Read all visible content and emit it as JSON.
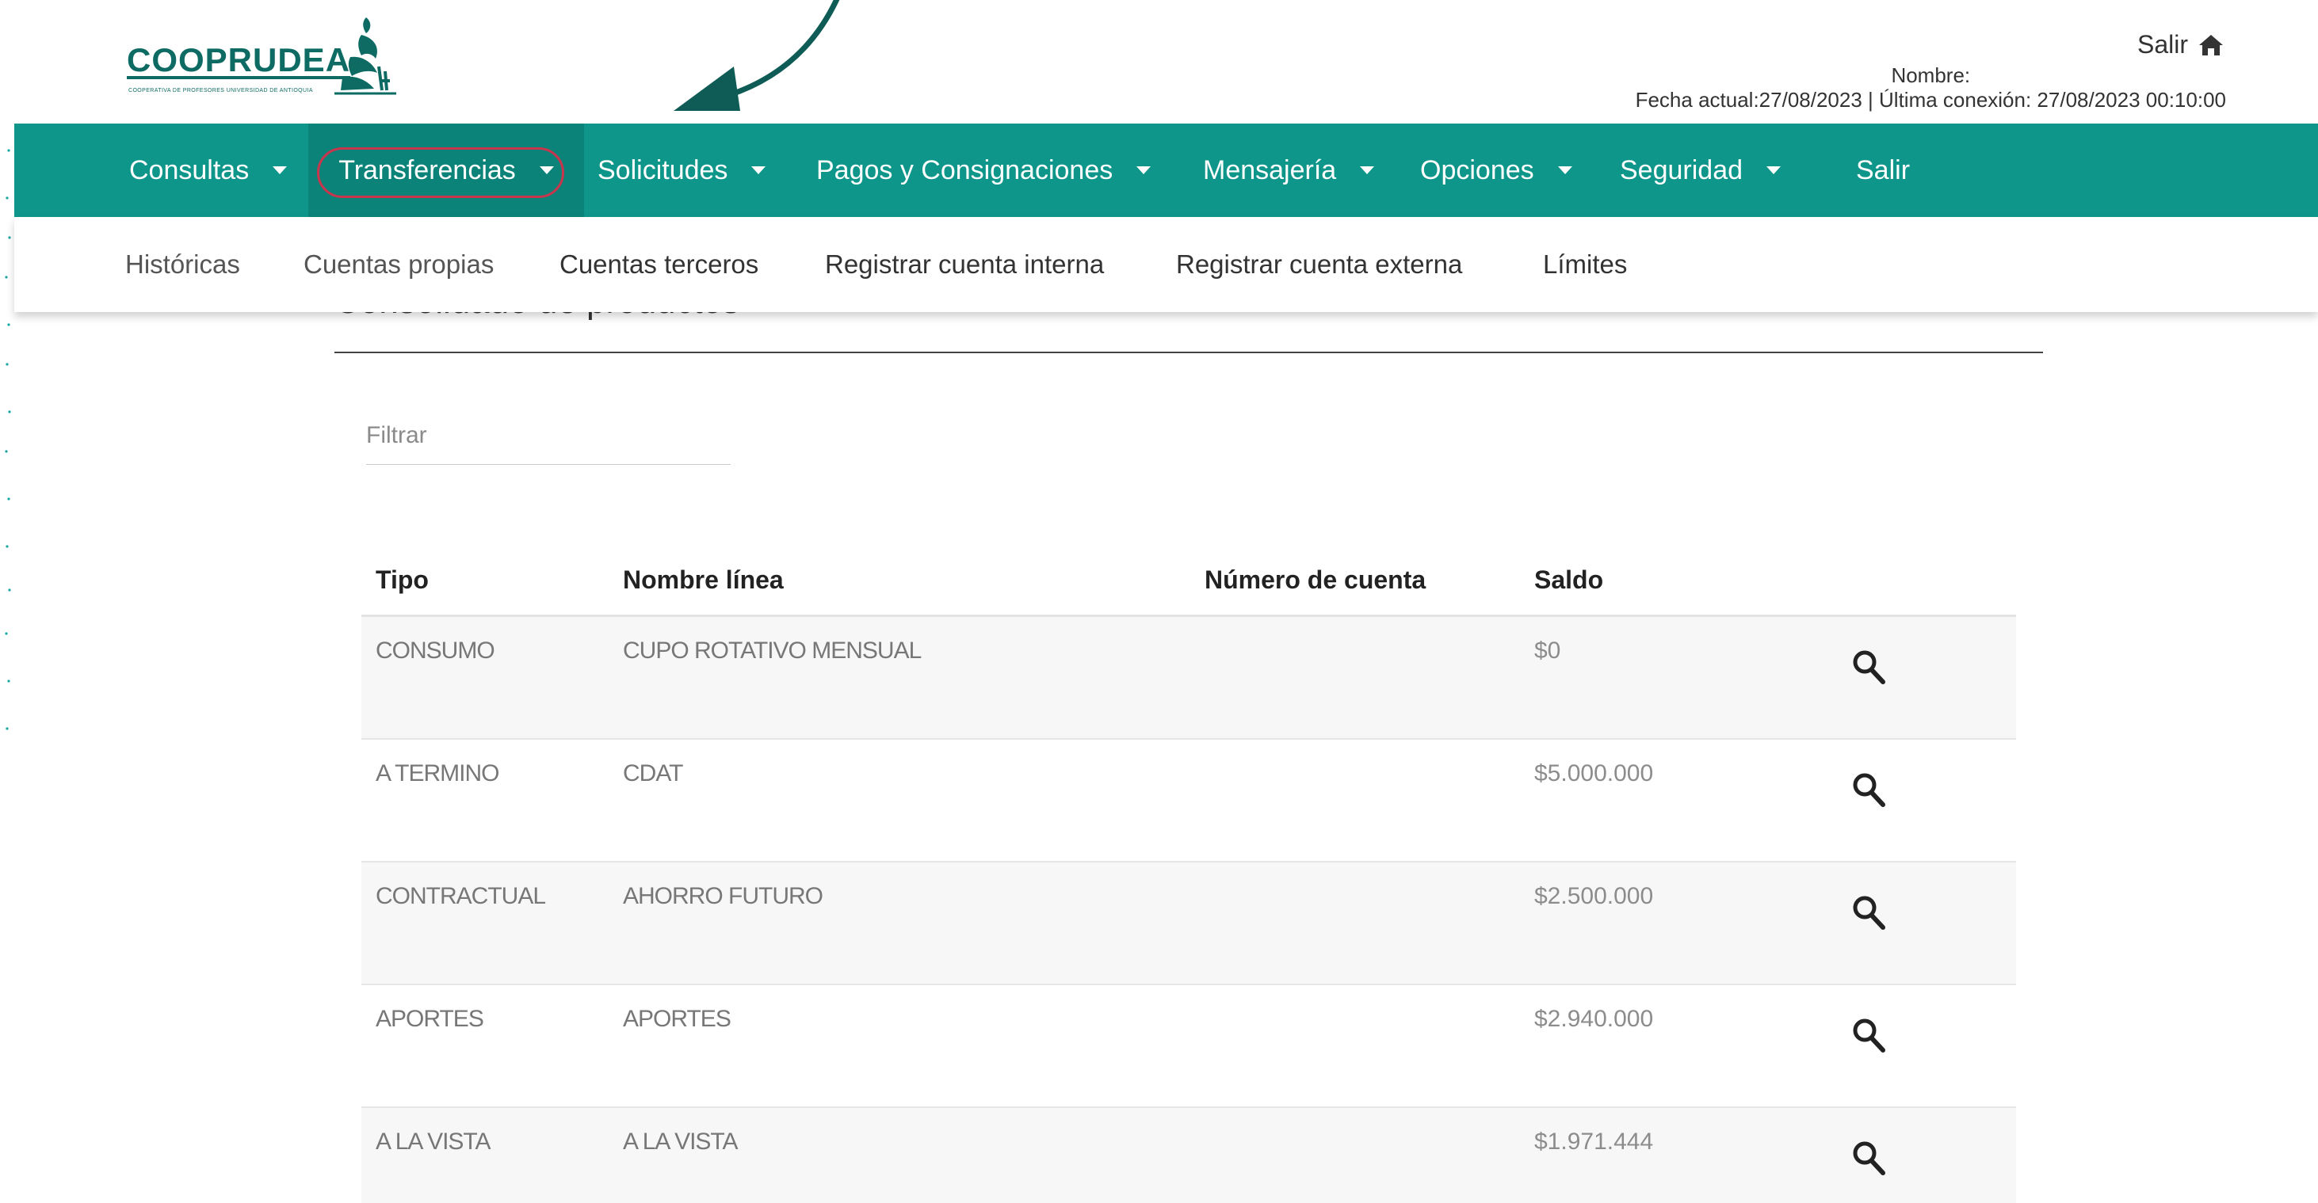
{
  "header": {
    "logo_text": "COOPRUDEA",
    "logo_subtitle": "COOPERATIVA DE PROFESORES UNIVERSIDAD DE ANTIOQUIA",
    "salir_label": "Salir",
    "nombre_label": "Nombre:",
    "fecha_line": "Fecha actual:27/08/2023 | Última conexión: 27/08/2023 00:10:00"
  },
  "nav": {
    "items": [
      {
        "label": "Consultas"
      },
      {
        "label": "Transferencias"
      },
      {
        "label": "Solicitudes"
      },
      {
        "label": "Pagos y Consignaciones"
      },
      {
        "label": "Mensajería"
      },
      {
        "label": "Opciones"
      },
      {
        "label": "Seguridad"
      },
      {
        "label": "Salir"
      }
    ],
    "active": "Transferencias"
  },
  "subnav": {
    "items": [
      {
        "label": "Históricas"
      },
      {
        "label": "Cuentas propias"
      },
      {
        "label": "Cuentas terceros"
      },
      {
        "label": "Registrar cuenta interna"
      },
      {
        "label": "Registrar cuenta externa"
      },
      {
        "label": "Límites"
      }
    ]
  },
  "main": {
    "section_title": "Consolidado de productos",
    "filter_placeholder": "Filtrar",
    "table": {
      "headers": {
        "tipo": "Tipo",
        "nombre": "Nombre línea",
        "numero": "Número de cuenta",
        "saldo": "Saldo"
      },
      "rows": [
        {
          "tipo": "CONSUMO",
          "nombre": "CUPO ROTATIVO MENSUAL",
          "numero": "",
          "saldo": "$0"
        },
        {
          "tipo": "A TERMINO",
          "nombre": "CDAT",
          "numero": "",
          "saldo": "$5.000.000"
        },
        {
          "tipo": "CONTRACTUAL",
          "nombre": "AHORRO FUTURO",
          "numero": "",
          "saldo": "$2.500.000"
        },
        {
          "tipo": "APORTES",
          "nombre": "APORTES",
          "numero": "",
          "saldo": "$2.940.000"
        },
        {
          "tipo": "A LA VISTA",
          "nombre": "A LA VISTA",
          "numero": "",
          "saldo": "$1.971.444"
        }
      ]
    }
  },
  "colors": {
    "brand_teal": "#0f968a",
    "logo_teal": "#0d6b64",
    "active_ring": "#c8364d",
    "arrow": "#0f5c56"
  },
  "icons": {
    "home": "home-icon",
    "search": "search-icon",
    "caret": "caret-down-icon",
    "annotation": "annotation-arrow-icon"
  }
}
